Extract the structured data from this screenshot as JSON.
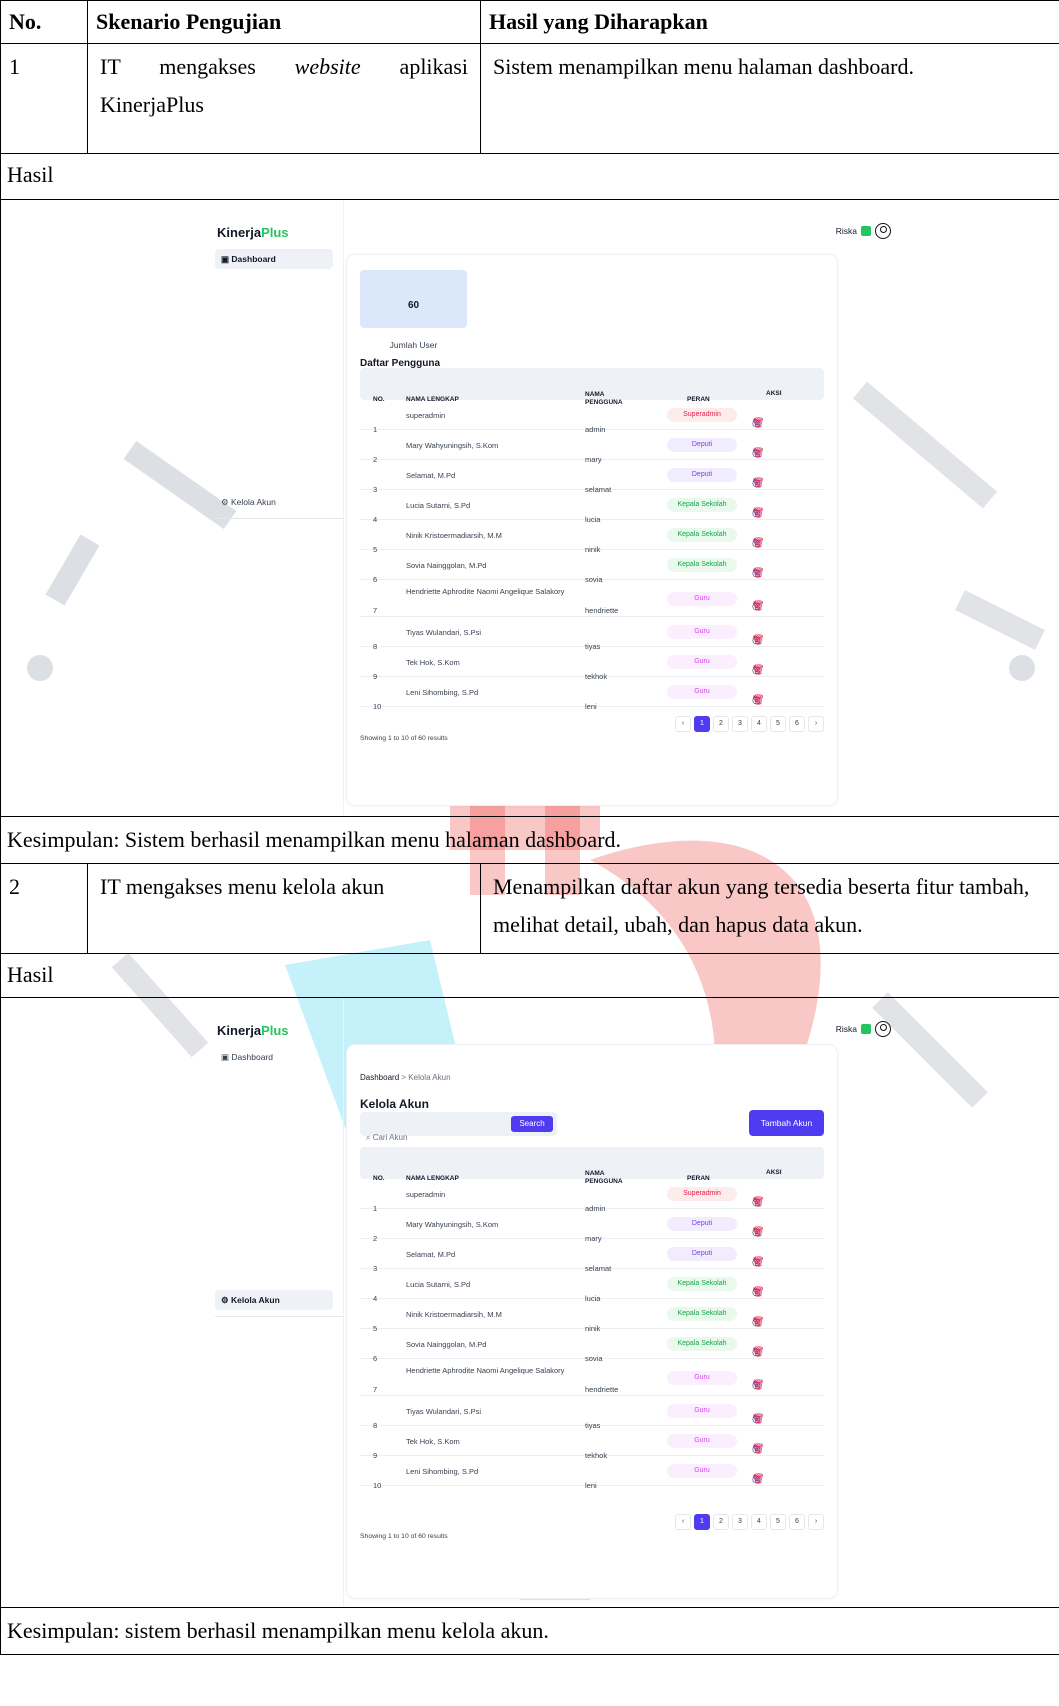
{
  "table": {
    "headers": [
      "No.",
      "Skenario Pengujian",
      "Hasil yang Diharapkan"
    ],
    "hasil_label": "Hasil",
    "tests": [
      {
        "no": "1",
        "scenario_pre": "IT mengakses ",
        "scenario_em": "website",
        "scenario_post": " aplikasi KinerjaPlus",
        "expected": "Sistem menampilkan menu halaman dashboard.",
        "conclusion": "Kesimpulan: Sistem berhasil menampilkan menu halaman dashboard."
      },
      {
        "no": "2",
        "scenario_pre": "IT mengakses menu kelola akun",
        "scenario_em": "",
        "scenario_post": "",
        "expected": "Menampilkan daftar akun yang tersedia beserta fitur tambah, melihat detail, ubah, dan hapus data akun.",
        "conclusion": "Kesimpulan: sistem berhasil menampilkan menu kelola akun."
      }
    ]
  },
  "app": {
    "brand_main": "Kinerja",
    "brand_accent": "Plus",
    "nav_dashboard": "Dashboard",
    "nav_kelola": "Kelola Akun",
    "user_name": "Riska",
    "stat_value": "60",
    "stat_label": "Jumlah User",
    "list_title": "Daftar Pengguna",
    "breadcrumb_home": "Dashboard",
    "breadcrumb_sep": ">",
    "breadcrumb_current": "Kelola Akun",
    "page_title": "Kelola Akun",
    "search_placeholder": "Cari Akun",
    "search_button": "Search",
    "add_button": "Tambah Akun",
    "columns": {
      "no": "NO.",
      "nama": "NAMA LENGKAP",
      "nama_pengguna_1": "NAMA",
      "nama_pengguna_2": "PENGGUNA",
      "peran": "PERAN",
      "aksi": "AKSI"
    },
    "users": [
      {
        "no": "1",
        "nama": "superadmin",
        "username": "admin",
        "peran": "Superadmin"
      },
      {
        "no": "2",
        "nama": "Mary Wahyuningsih, S.Kom",
        "username": "mary",
        "peran": "Deputi"
      },
      {
        "no": "3",
        "nama": "Selamat, M.Pd",
        "username": "selamat",
        "peran": "Deputi"
      },
      {
        "no": "4",
        "nama": "Lucia Sutarni, S.Pd",
        "username": "lucia",
        "peran": "Kepala Sekolah"
      },
      {
        "no": "5",
        "nama": "Ninik Kristoermadiarsih, M.M",
        "username": "ninik",
        "peran": "Kepala Sekolah"
      },
      {
        "no": "6",
        "nama": "Sovia Nainggolan, M.Pd",
        "username": "sovia",
        "peran": "Kepala Sekolah"
      },
      {
        "no": "7",
        "nama": "Hendriette Aphrodite Naomi Angelique Salakory",
        "username": "hendriette",
        "peran": "Guru"
      },
      {
        "no": "8",
        "nama": "Tiyas Wulandari, S.Psi",
        "username": "tiyas",
        "peran": "Guru"
      },
      {
        "no": "9",
        "nama": "Tek Hok, S.Kom",
        "username": "tekhok",
        "peran": "Guru"
      },
      {
        "no": "10",
        "nama": "Leni Sihombing, S.Pd",
        "username": "leni",
        "peran": "Guru"
      }
    ],
    "showing": "Showing 1 to 10 of 60 results",
    "pages": [
      "‹",
      "1",
      "2",
      "3",
      "4",
      "5",
      "6",
      "›"
    ],
    "active_page": "1",
    "icons": {
      "view": "eye-icon",
      "edit": "edit-icon",
      "delete": "trash-icon"
    },
    "colors": {
      "accent": "#4f3cf0",
      "brand_green": "#22c55e"
    }
  }
}
